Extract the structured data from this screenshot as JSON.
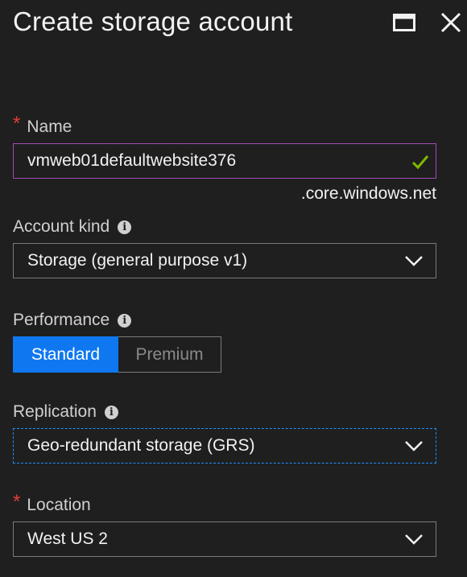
{
  "header": {
    "title": "Create storage account"
  },
  "name_field": {
    "label": "Name",
    "required": true,
    "value": "vmweb01defaultwebsite376",
    "suffix": ".core.windows.net",
    "valid_icon": "checkmark-icon"
  },
  "account_kind": {
    "label": "Account kind",
    "value": "Storage (general purpose v1)"
  },
  "performance": {
    "label": "Performance",
    "options": [
      "Standard",
      "Premium"
    ],
    "selected": "Standard"
  },
  "replication": {
    "label": "Replication",
    "value": "Geo-redundant storage (GRS)"
  },
  "location": {
    "label": "Location",
    "required": true,
    "value": "West US 2"
  },
  "colors": {
    "background": "#1f1f1f",
    "accent": "#0f78f0",
    "required": "#e23b3b",
    "valid": "#7fba00",
    "name_border": "#a34ab5"
  }
}
